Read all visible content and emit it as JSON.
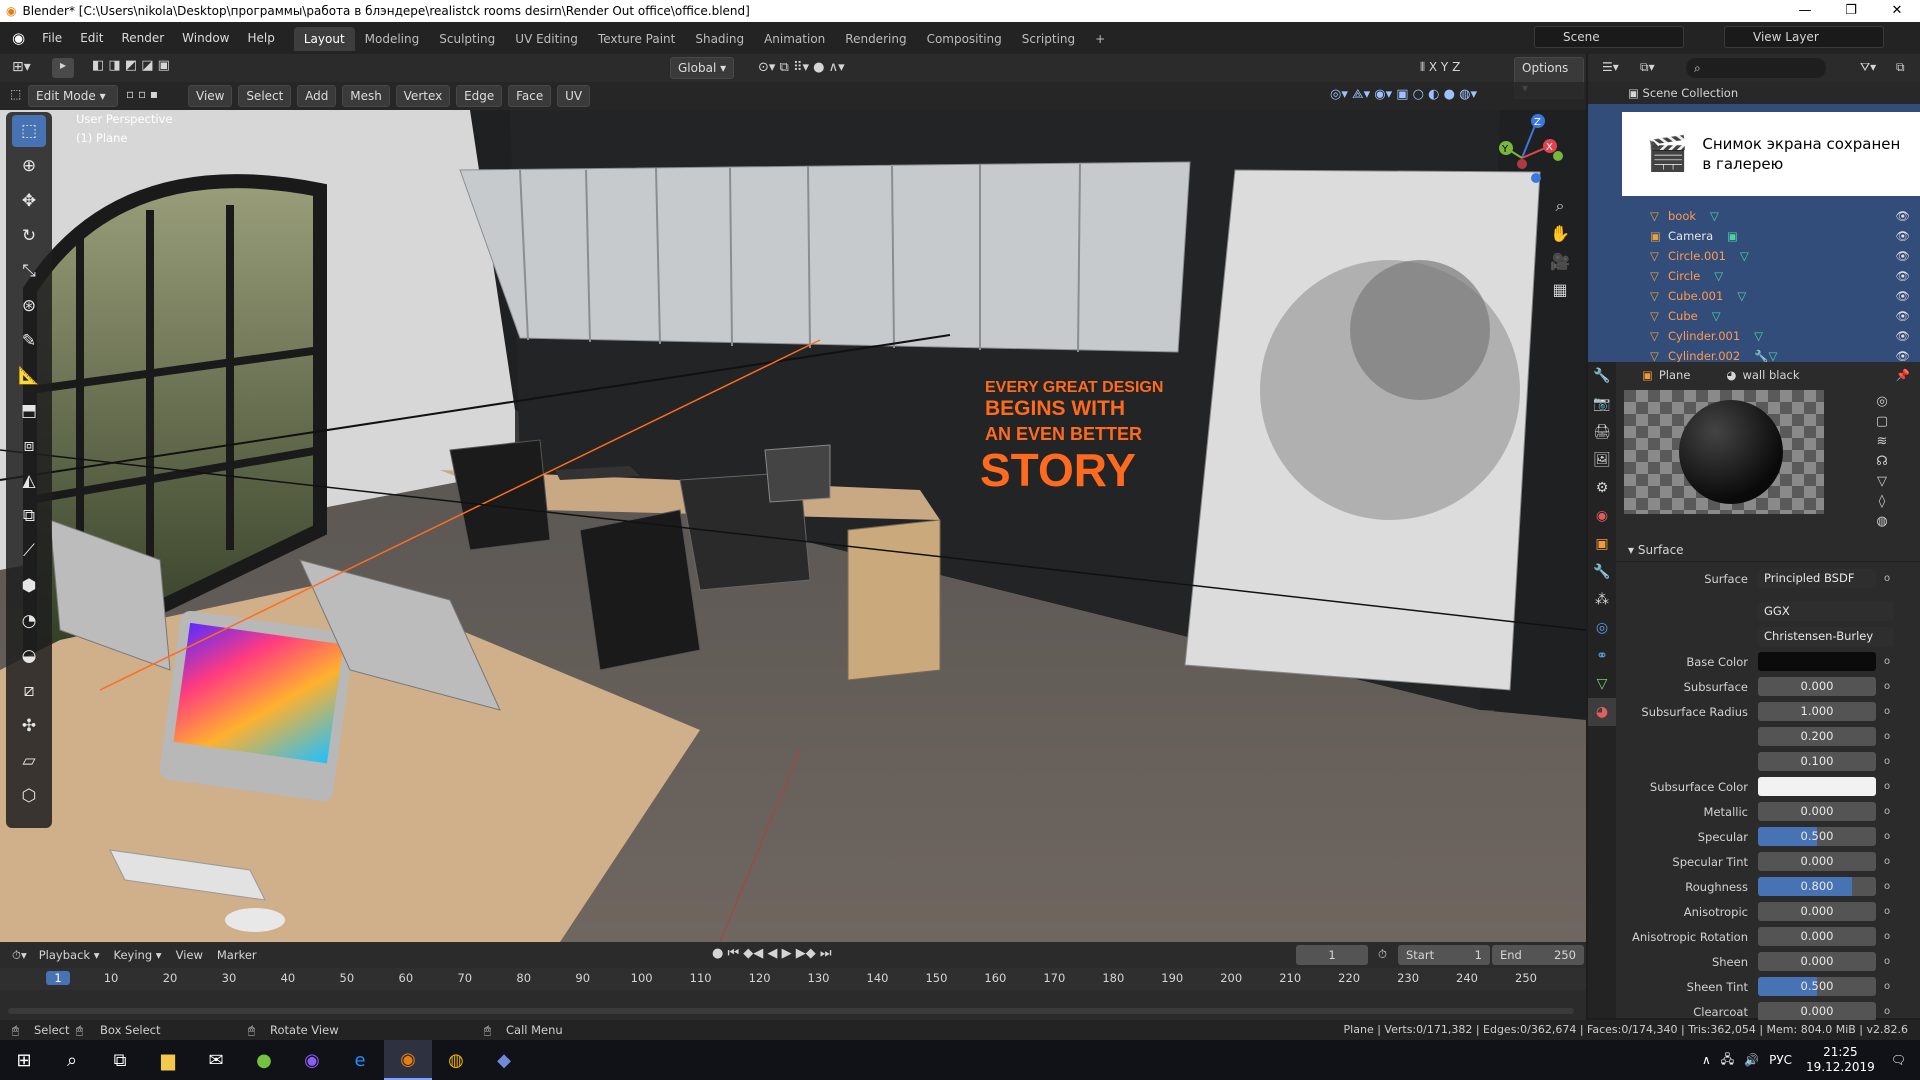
{
  "window": {
    "title": "Blender* [C:\\Users\\nikola\\Desktop\\программы\\работа в блэндере\\realistck rooms desirn\\Render Out office\\office.blend]",
    "minimize": "—",
    "maximize": "❐",
    "close": "✕"
  },
  "menu": [
    "File",
    "Edit",
    "Render",
    "Window",
    "Help"
  ],
  "workspaces": [
    "Layout",
    "Modeling",
    "Sculpting",
    "UV Editing",
    "Texture Paint",
    "Shading",
    "Animation",
    "Rendering",
    "Compositing",
    "Scripting"
  ],
  "active_workspace": "Layout",
  "add_workspace": "+",
  "scene": "Scene",
  "view_layer": "View Layer",
  "viewport": {
    "mode": "Edit Mode",
    "header_menus": [
      "View",
      "Select",
      "Add",
      "Mesh",
      "Vertex",
      "Edge",
      "Face",
      "UV"
    ],
    "transform_orientation": "Global",
    "options": "Options",
    "axis_toggles": [
      "X",
      "Y",
      "Z"
    ],
    "overlay_line1": "User Perspective",
    "overlay_line2": "(1) Plane",
    "wall_text": {
      "line1": "EVERY GREAT DESIGN",
      "line2": "BEGINS WITH",
      "line3": "AN EVEN BETTER",
      "line4": "STORY"
    },
    "gizmo_axes": {
      "x": "X",
      "y": "Y",
      "z": "Z"
    }
  },
  "outliner": {
    "header": "Scene Collection",
    "rows": [
      "book",
      "Camera",
      "Circle.001",
      "Circle",
      "Cube.001",
      "Cube",
      "Cylinder.001",
      "Cylinder.002"
    ]
  },
  "toast": {
    "line1": "Снимок экрана сохранен",
    "line2": "в галерею"
  },
  "properties": {
    "object": "Plane",
    "material": "wall black",
    "section": "Surface",
    "surface_label": "Surface",
    "surface_value": "Principled BSDF",
    "distribution": "GGX",
    "subsurface_method": "Christensen-Burley",
    "fields": [
      {
        "label": "Base Color",
        "value": "",
        "type": "color",
        "color": "#0b0b0b"
      },
      {
        "label": "Subsurface",
        "value": "0.000",
        "fill": 0
      },
      {
        "label": "Subsurface Radius",
        "value": "1.000",
        "fill": 0
      },
      {
        "label": "",
        "value": "0.200",
        "fill": 0
      },
      {
        "label": "",
        "value": "0.100",
        "fill": 0
      },
      {
        "label": "Subsurface Color",
        "value": "",
        "type": "color",
        "color": "#f2f2f2"
      },
      {
        "label": "Metallic",
        "value": "0.000",
        "fill": 0
      },
      {
        "label": "Specular",
        "value": "0.500",
        "fill": 0.5
      },
      {
        "label": "Specular Tint",
        "value": "0.000",
        "fill": 0
      },
      {
        "label": "Roughness",
        "value": "0.800",
        "fill": 0.8
      },
      {
        "label": "Anisotropic",
        "value": "0.000",
        "fill": 0
      },
      {
        "label": "Anisotropic Rotation",
        "value": "0.000",
        "fill": 0
      },
      {
        "label": "Sheen",
        "value": "0.000",
        "fill": 0
      },
      {
        "label": "Sheen Tint",
        "value": "0.500",
        "fill": 0.5
      },
      {
        "label": "Clearcoat",
        "value": "0.000",
        "fill": 0
      }
    ]
  },
  "timeline": {
    "menus": [
      "Playback",
      "Keying",
      "View",
      "Marker"
    ],
    "current_frame": "1",
    "start_label": "Start",
    "start": "1",
    "end_label": "End",
    "end": "250",
    "ticks": [
      "1",
      "10",
      "20",
      "30",
      "40",
      "50",
      "60",
      "70",
      "80",
      "90",
      "100",
      "110",
      "120",
      "130",
      "140",
      "150",
      "160",
      "170",
      "180",
      "190",
      "200",
      "210",
      "220",
      "230",
      "240",
      "250"
    ]
  },
  "statusbar": {
    "select": "Select",
    "box_select": "Box Select",
    "rotate_view": "Rotate View",
    "call_menu": "Call Menu",
    "stats": "Plane | Verts:0/171,382 | Edges:0/362,674 | Faces:0/174,340 | Tris:362,054 | Mem: 804.0 MiB | v2.82.6"
  },
  "taskbar": {
    "lang": "РУС",
    "time": "21:25",
    "date": "19.12.2019"
  }
}
